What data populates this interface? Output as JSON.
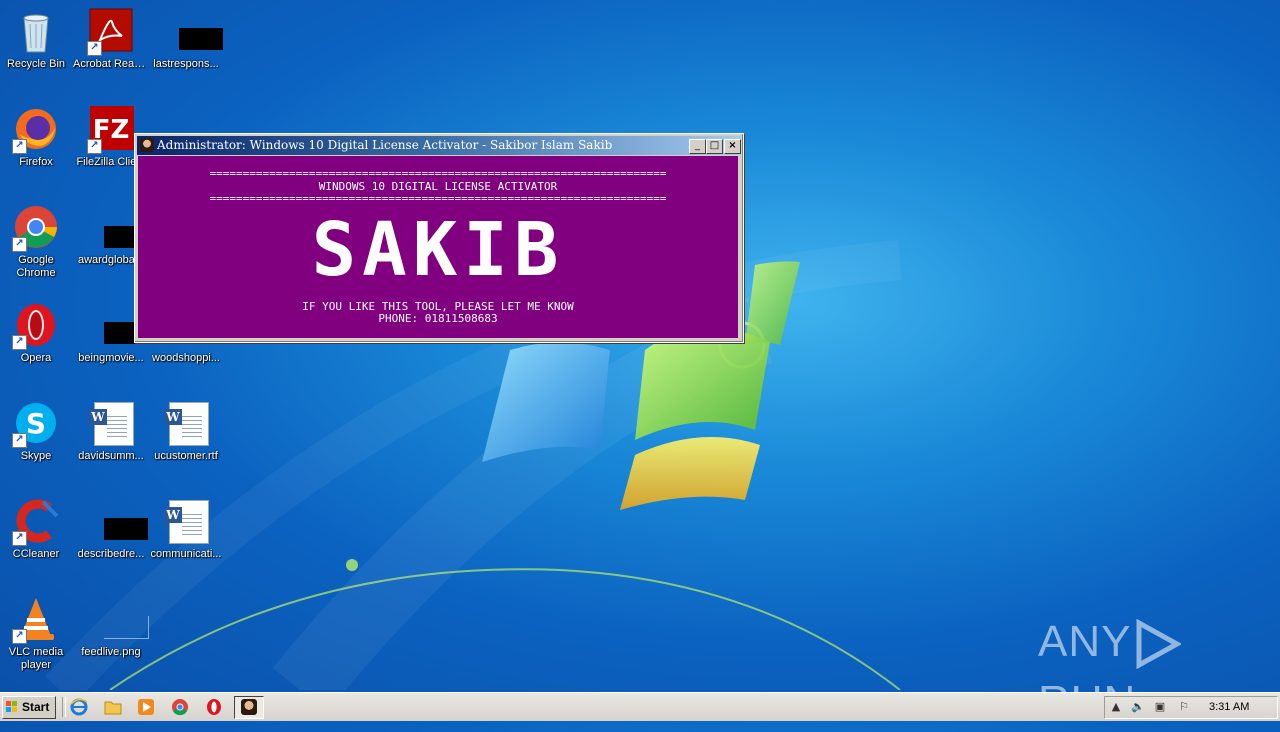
{
  "desktop": {
    "icons": [
      {
        "label": "Recycle Bin",
        "icon": "recycle-bin-icon"
      },
      {
        "label": "Acrobat Reader DC",
        "icon": "acrobat-reader-icon"
      },
      {
        "label": "lastrespons...",
        "icon": "file-thumbnail-icon"
      },
      {
        "label": "Firefox",
        "icon": "firefox-icon"
      },
      {
        "label": "FileZilla Clie...",
        "icon": "filezilla-icon"
      },
      {
        "label": "Google Chrome",
        "icon": "chrome-icon"
      },
      {
        "label": "awardgloba...",
        "icon": "file-thumbnail-icon"
      },
      {
        "label": "Opera",
        "icon": "opera-icon"
      },
      {
        "label": "beingmovie...",
        "icon": "file-thumbnail-icon"
      },
      {
        "label": "woodshoppi...",
        "icon": "file-thumbnail-icon"
      },
      {
        "label": "Skype",
        "icon": "skype-icon"
      },
      {
        "label": "davidsumm...",
        "icon": "word-document-icon"
      },
      {
        "label": "ucustomer.rtf",
        "icon": "word-document-icon"
      },
      {
        "label": "CCleaner",
        "icon": "ccleaner-icon"
      },
      {
        "label": "describedre...",
        "icon": "file-thumbnail-icon"
      },
      {
        "label": "communicati...",
        "icon": "word-document-icon"
      },
      {
        "label": "VLC media player",
        "icon": "vlc-icon"
      },
      {
        "label": "feedlive.png",
        "icon": "image-file-icon"
      }
    ]
  },
  "console_window": {
    "title": "Administrator:  Windows 10 Digital License Activator - Sakibor Islam Sakib",
    "background_color": "#800080",
    "separator": "=====================================================================",
    "heading": "WINDOWS 10 DIGITAL LICENSE ACTIVATOR",
    "banner": "SAKIB",
    "message_line1": "IF YOU LIKE THIS TOOL, PLEASE LET ME KNOW",
    "message_line2": "PHONE: 01811508683",
    "buttons": {
      "minimize": "_",
      "maximize": "□",
      "close": "×"
    }
  },
  "taskbar": {
    "start_label": "Start",
    "quick_launch": [
      "internet-explorer-icon",
      "folder-icon",
      "media-player-icon",
      "chrome-icon",
      "opera-icon"
    ],
    "active_task_icon": "console-user-icon",
    "tray_icons": [
      "show-hidden-icons-icon",
      "volume-icon",
      "network-icon",
      "action-center-flag-icon"
    ],
    "clock": "3:31 AM"
  },
  "watermark": {
    "left": "ANY",
    "right": "RUN"
  }
}
